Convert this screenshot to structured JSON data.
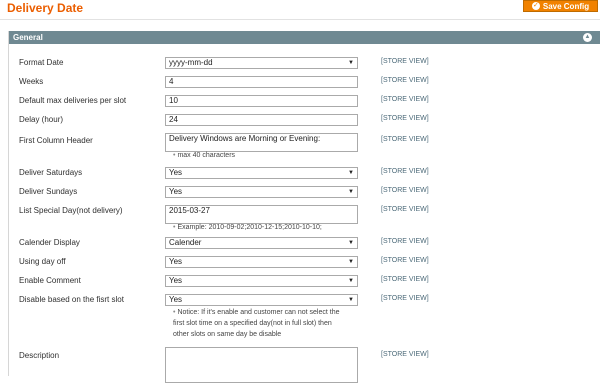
{
  "page": {
    "title": "Delivery Date",
    "save_label": "Save Config",
    "section_title": "General"
  },
  "colors": {
    "accent": "#eb5e00",
    "button": "#f18200",
    "section_header": "#6f8992",
    "scope_text": "#4c6a79"
  },
  "icons": {
    "save": "check-circle-icon",
    "collapse": "collapse-up-icon",
    "dropdown": "chevron-down-icon"
  },
  "fields": {
    "format_date": {
      "label": "Format Date",
      "value": "yyyy-mm-dd",
      "scope": "[STORE VIEW]"
    },
    "weeks": {
      "label": "Weeks",
      "value": "4",
      "scope": "[STORE VIEW]"
    },
    "max_deliveries": {
      "label": "Default max deliveries per slot",
      "value": "10",
      "scope": "[STORE VIEW]"
    },
    "delay": {
      "label": "Delay (hour)",
      "value": "24",
      "scope": "[STORE VIEW]"
    },
    "first_column_header": {
      "label": "First Column Header",
      "value": "Delivery Windows are Morning or Evening:",
      "note": "max 40 characters",
      "scope": "[STORE VIEW]"
    },
    "deliver_saturdays": {
      "label": "Deliver Saturdays",
      "value": "Yes",
      "scope": "[STORE VIEW]"
    },
    "deliver_sundays": {
      "label": "Deliver Sundays",
      "value": "Yes",
      "scope": "[STORE VIEW]"
    },
    "special_day": {
      "label": "List Special Day(not delivery)",
      "value": "2015-03-27",
      "note": "Example: 2010-09-02;2010-12-15;2010-10-10;",
      "scope": "[STORE VIEW]"
    },
    "calender_display": {
      "label": "Calender Display",
      "value": "Calender",
      "scope": "[STORE VIEW]"
    },
    "using_day_off": {
      "label": "Using day off",
      "value": "Yes",
      "scope": "[STORE VIEW]"
    },
    "enable_comment": {
      "label": "Enable Comment",
      "value": "Yes",
      "scope": "[STORE VIEW]"
    },
    "disable_first_slot": {
      "label": "Disable based on the fisrt slot",
      "value": "Yes",
      "note_line1": "Notice: If it's enable and customer can not select the",
      "note_line2": "first slot time on a specified day(not in full slot) then",
      "note_line3": "other slots on same day be disable",
      "scope": "[STORE VIEW]"
    },
    "description": {
      "label": "Description",
      "value": "",
      "scope": "[STORE VIEW]"
    }
  }
}
